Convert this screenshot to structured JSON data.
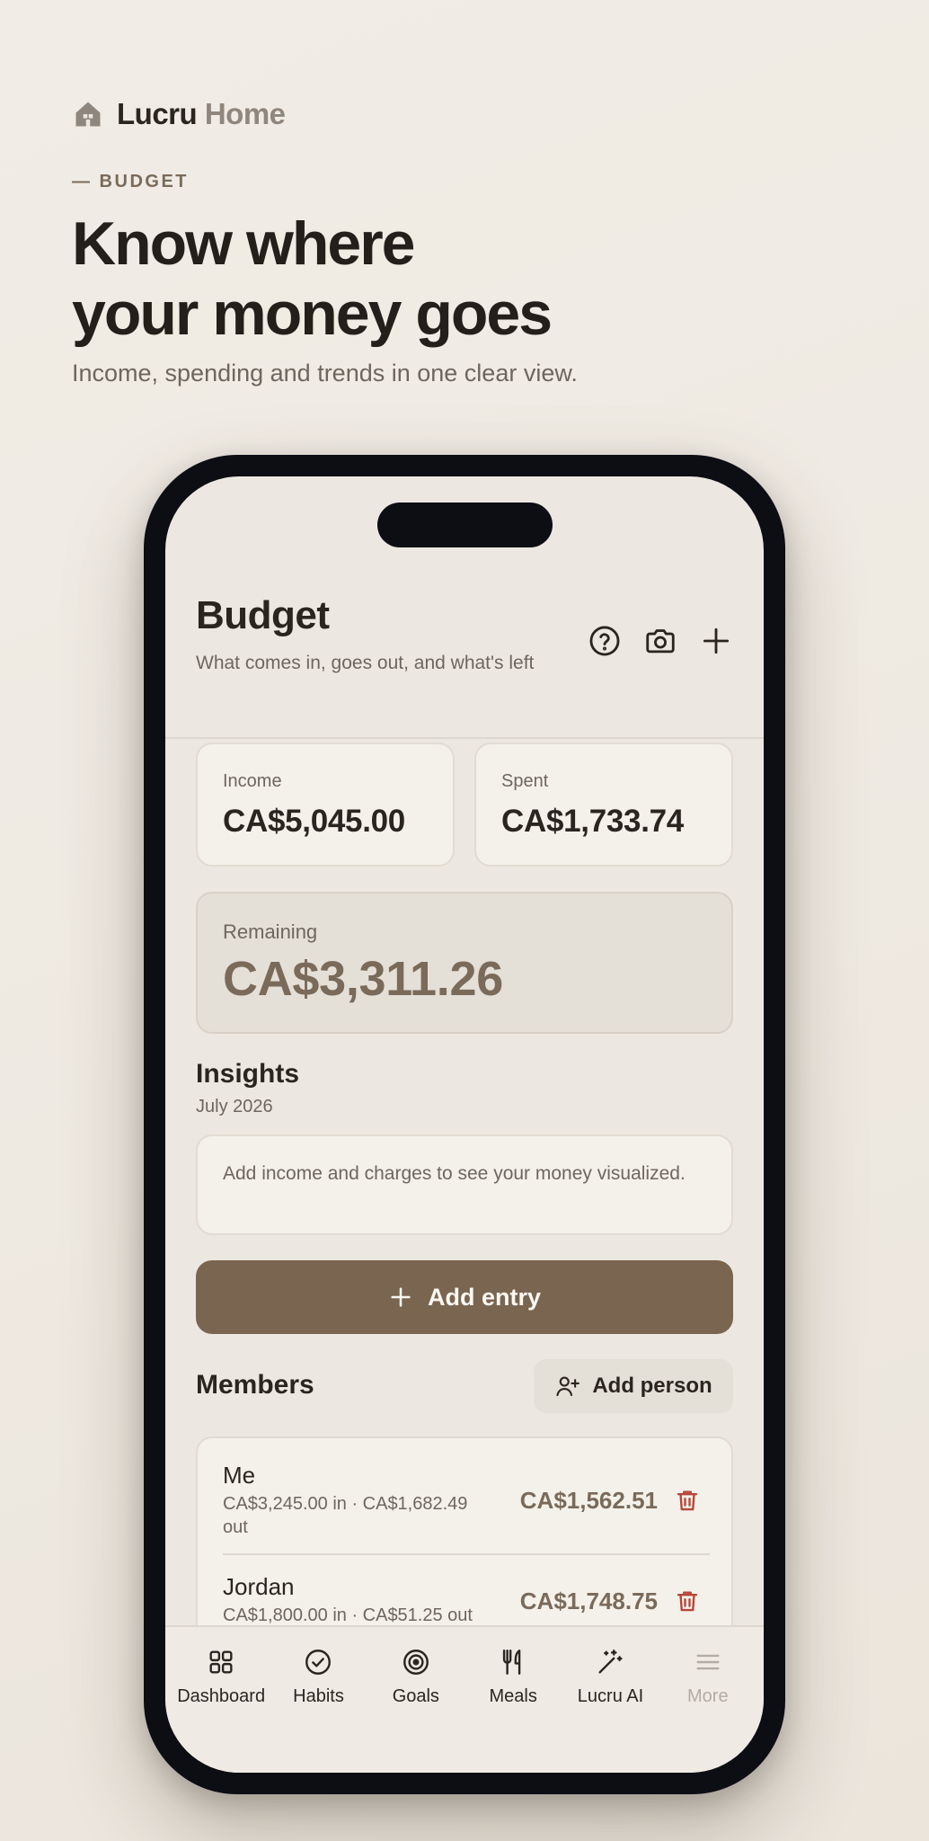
{
  "brand": {
    "name_a": "Lucru",
    "name_b": "Home",
    "icon": "house-icon"
  },
  "eyebrow": "— BUDGET",
  "headline": {
    "line1": "Know where",
    "line2": "your money goes"
  },
  "subhead": "Income, spending and trends in one clear view.",
  "app": {
    "title": "Budget",
    "subtitle": "What comes in, goes out, and what's left",
    "header_icons": [
      "help-circle-icon",
      "camera-icon",
      "plus-icon"
    ],
    "summary": {
      "income_label": "Income",
      "income_value": "CA$5,045.00",
      "spent_label": "Spent",
      "spent_value": "CA$1,733.74",
      "remaining_label": "Remaining",
      "remaining_value": "CA$3,311.26"
    },
    "insights": {
      "title": "Insights",
      "period": "July 2026",
      "empty_text": "Add income and charges to see your money visualized."
    },
    "add_entry_label": "Add entry",
    "members": {
      "title": "Members",
      "add_person_label": "Add person",
      "items": [
        {
          "name": "Me",
          "detail": "CA$3,245.00 in · CA$1,682.49 out",
          "balance": "CA$1,562.51"
        },
        {
          "name": "Jordan",
          "detail": "CA$1,800.00 in · CA$51.25 out",
          "balance": "CA$1,748.75"
        }
      ]
    },
    "tabs": [
      {
        "label": "Dashboard",
        "icon": "grid-icon"
      },
      {
        "label": "Habits",
        "icon": "check-circle-icon"
      },
      {
        "label": "Goals",
        "icon": "target-icon"
      },
      {
        "label": "Meals",
        "icon": "utensils-icon"
      },
      {
        "label": "Lucru AI",
        "icon": "magic-wand-icon"
      },
      {
        "label": "More",
        "icon": "menu-icon"
      }
    ],
    "colors": {
      "accent": "#7a6550",
      "background": "#ece8e1",
      "card": "#f4f1ea",
      "danger": "#b5473a"
    }
  }
}
